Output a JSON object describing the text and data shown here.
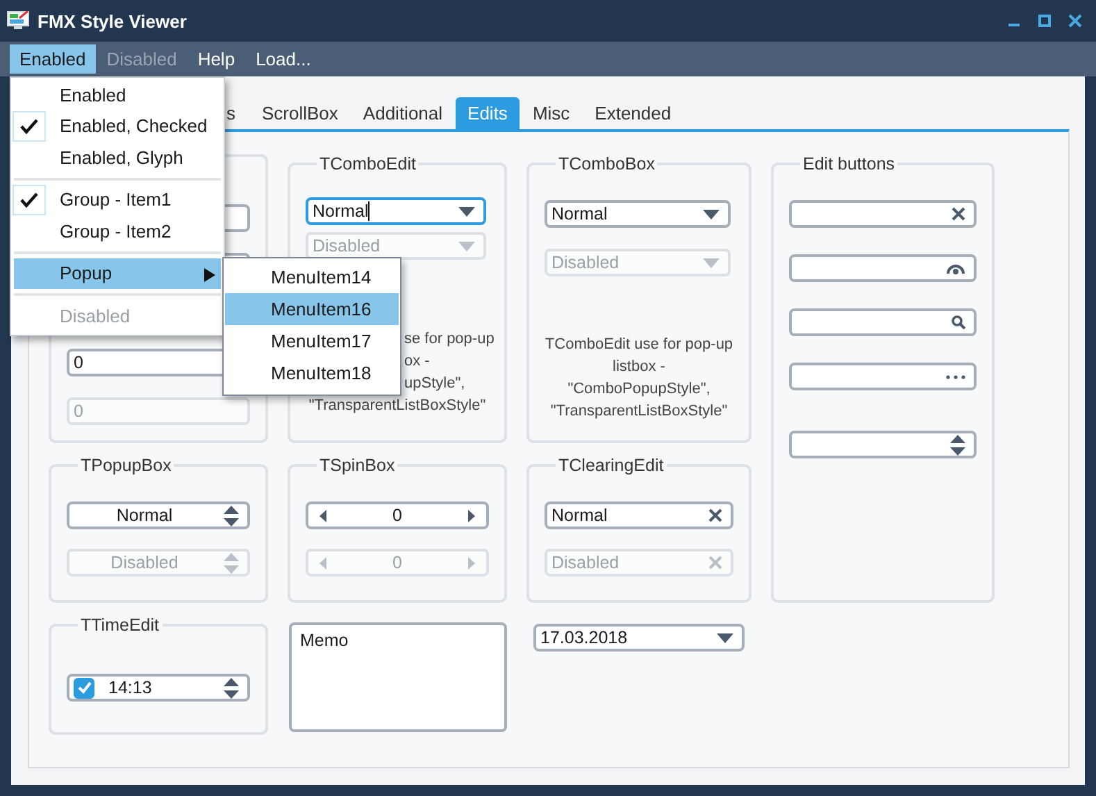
{
  "window": {
    "title": "FMX Style Viewer"
  },
  "menu_bar": [
    {
      "label": "Enabled",
      "selected": true,
      "disabled": false
    },
    {
      "label": "Disabled",
      "selected": false,
      "disabled": true
    },
    {
      "label": "Help",
      "selected": false,
      "disabled": false
    },
    {
      "label": "Load...",
      "selected": false,
      "disabled": false
    }
  ],
  "dropdown_menu": {
    "items": [
      {
        "kind": "item",
        "label": "Enabled",
        "checked": false,
        "selected": false,
        "disabled": false
      },
      {
        "kind": "item",
        "label": "Enabled, Checked",
        "checked": true,
        "selected": false,
        "disabled": false
      },
      {
        "kind": "item",
        "label": "Enabled, Glyph",
        "checked": false,
        "selected": false,
        "disabled": false
      },
      {
        "kind": "separator"
      },
      {
        "kind": "item",
        "label": "Group - Item1",
        "checked": true,
        "selected": false,
        "disabled": false
      },
      {
        "kind": "item",
        "label": "Group - Item2",
        "checked": false,
        "selected": false,
        "disabled": false
      },
      {
        "kind": "separator"
      },
      {
        "kind": "submenu",
        "label": "Popup",
        "checked": false,
        "selected": true,
        "disabled": false
      },
      {
        "kind": "separator"
      },
      {
        "kind": "item",
        "label": "Disabled",
        "checked": false,
        "selected": false,
        "disabled": true
      }
    ]
  },
  "submenu": {
    "items": [
      {
        "label": "MenuItem14",
        "selected": false
      },
      {
        "label": "MenuItem16",
        "selected": true
      },
      {
        "label": "MenuItem17",
        "selected": false
      },
      {
        "label": "MenuItem18",
        "selected": false
      }
    ]
  },
  "tabs": [
    {
      "label": "s",
      "selected": false
    },
    {
      "label": "ScrollBox",
      "selected": false
    },
    {
      "label": "Additional",
      "selected": false
    },
    {
      "label": "Edits",
      "selected": true
    },
    {
      "label": "Misc",
      "selected": false
    },
    {
      "label": "Extended",
      "selected": false
    }
  ],
  "groups": [
    {
      "kind": "group",
      "controls": [
        {
          "kind": "edit",
          "disabled": false
        },
        {
          "kind": "edit",
          "disabled": false
        },
        {
          "kind": "edit",
          "value": "0",
          "disabled": false
        },
        {
          "kind": "edit",
          "value": "0",
          "disabled": true
        }
      ]
    },
    {
      "kind": "group",
      "title": "TComboEdit",
      "controls": [
        {
          "kind": "combo",
          "value": "Normal",
          "disabled": false,
          "focused": true
        },
        {
          "kind": "combo",
          "value": "Disabled",
          "disabled": true,
          "focused": false
        }
      ],
      "note": [
        "se for pop-up",
        "ox -",
        "upStyle\",",
        "\"TransparentListBoxStyle\""
      ]
    },
    {
      "kind": "group",
      "title": "TComboBox",
      "controls": [
        {
          "kind": "combo",
          "value": "Normal",
          "disabled": false
        },
        {
          "kind": "combo",
          "value": "Disabled",
          "disabled": true
        }
      ],
      "note": [
        "TComboEdit use for pop-up",
        "listbox -",
        "\"ComboPopupStyle\",",
        "\"TransparentListBoxStyle\""
      ]
    },
    {
      "kind": "group",
      "title": "Edit buttons",
      "controls": [
        {
          "kind": "clear_edit",
          "disabled": false
        },
        {
          "kind": "password_edit",
          "disabled": false
        },
        {
          "kind": "search_edit",
          "disabled": false
        },
        {
          "kind": "ellipsis_edit",
          "disabled": false
        },
        {
          "kind": "spin_edit",
          "disabled": false
        }
      ]
    },
    {
      "kind": "group",
      "title": "TPopupBox",
      "controls": [
        {
          "kind": "popup",
          "value": "Normal",
          "disabled": false
        },
        {
          "kind": "popup",
          "value": "Disabled",
          "disabled": true
        }
      ]
    },
    {
      "kind": "group",
      "title": "TSpinBox",
      "controls": [
        {
          "kind": "spin",
          "value": "0",
          "disabled": false
        },
        {
          "kind": "spin",
          "value": "0",
          "disabled": true
        }
      ]
    },
    {
      "kind": "group",
      "title": "TClearingEdit",
      "controls": [
        {
          "kind": "clearing",
          "value": "Normal",
          "disabled": false
        },
        {
          "kind": "clearing",
          "value": "Disabled",
          "disabled": true
        }
      ]
    },
    {
      "kind": "group",
      "title": "TTimeEdit",
      "controls": [
        {
          "kind": "time",
          "value": "14:13",
          "checked": true,
          "disabled": false
        }
      ]
    },
    {
      "kind": "memo",
      "value": "Memo"
    },
    {
      "kind": "date",
      "value": "17.03.2018"
    }
  ]
}
